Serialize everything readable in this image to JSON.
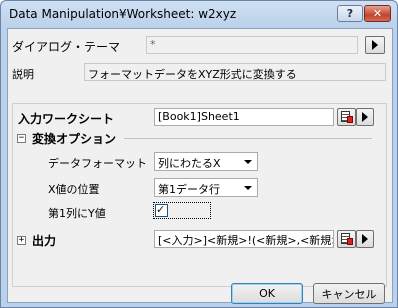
{
  "window": {
    "title": "Data Manipulation¥Worksheet: w2xyz",
    "help_label": "?",
    "close_label": "✕"
  },
  "theme": {
    "label": "ダイアログ・テーマ",
    "value": "*"
  },
  "description": {
    "label": "説明",
    "text": "フォーマットデータをXYZ形式に変換する"
  },
  "input": {
    "label": "入力ワークシート",
    "value": "[Book1]Sheet1"
  },
  "conversion": {
    "label": "変換オプション",
    "expander": "−",
    "data_format": {
      "label": "データフォーマット",
      "value": "列にわたるX"
    },
    "x_position": {
      "label": "X値の位置",
      "value": "第1データ行"
    },
    "first_col_y": {
      "label": "第1列にY値",
      "checked": true,
      "mark": "✓"
    }
  },
  "output": {
    "label": "出力",
    "expander": "+",
    "value": "[<入力>]<新規>!(<新規>,<新規>"
  },
  "buttons": {
    "ok": "OK",
    "cancel": "キャンセル"
  },
  "icons": {
    "theme_arrow": "triangle-right-icon",
    "sheet_picker": "worksheet-select-icon",
    "menu_arrow": "triangle-right-icon",
    "dropdown": "chevron-down-icon"
  }
}
